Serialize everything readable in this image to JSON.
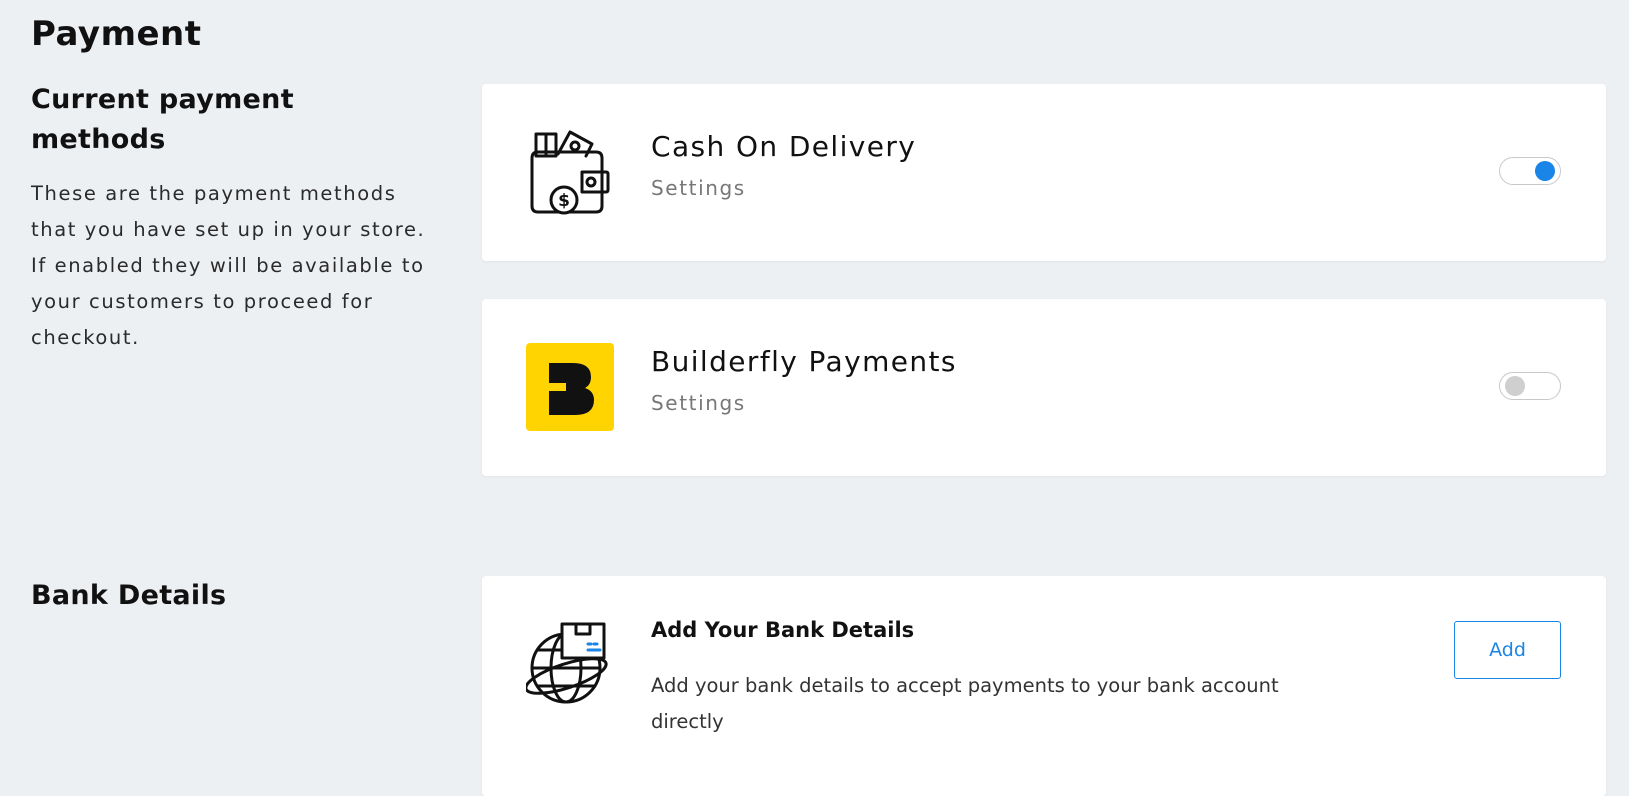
{
  "page": {
    "title": "Payment"
  },
  "payment_section": {
    "heading": "Current payment methods",
    "description": "These are the payment methods that you have set up in your store. If enabled they will be available to your customers to proceed for checkout."
  },
  "methods": [
    {
      "name": "Cash On Delivery",
      "settings_label": "Settings",
      "icon": "wallet-cash-icon",
      "enabled": true
    },
    {
      "name": "Builderfly Payments",
      "settings_label": "Settings",
      "icon": "builderfly-logo",
      "enabled": false
    }
  ],
  "bank_section": {
    "heading": "Bank Details",
    "card_title": "Add Your Bank Details",
    "card_description": "Add your bank details to accept payments to your bank account directly",
    "add_label": "Add",
    "icon": "globe-delivery-icon"
  },
  "colors": {
    "background": "#edf0f3",
    "accent": "#1a85e6",
    "builderfly_yellow": "#ffd400"
  }
}
